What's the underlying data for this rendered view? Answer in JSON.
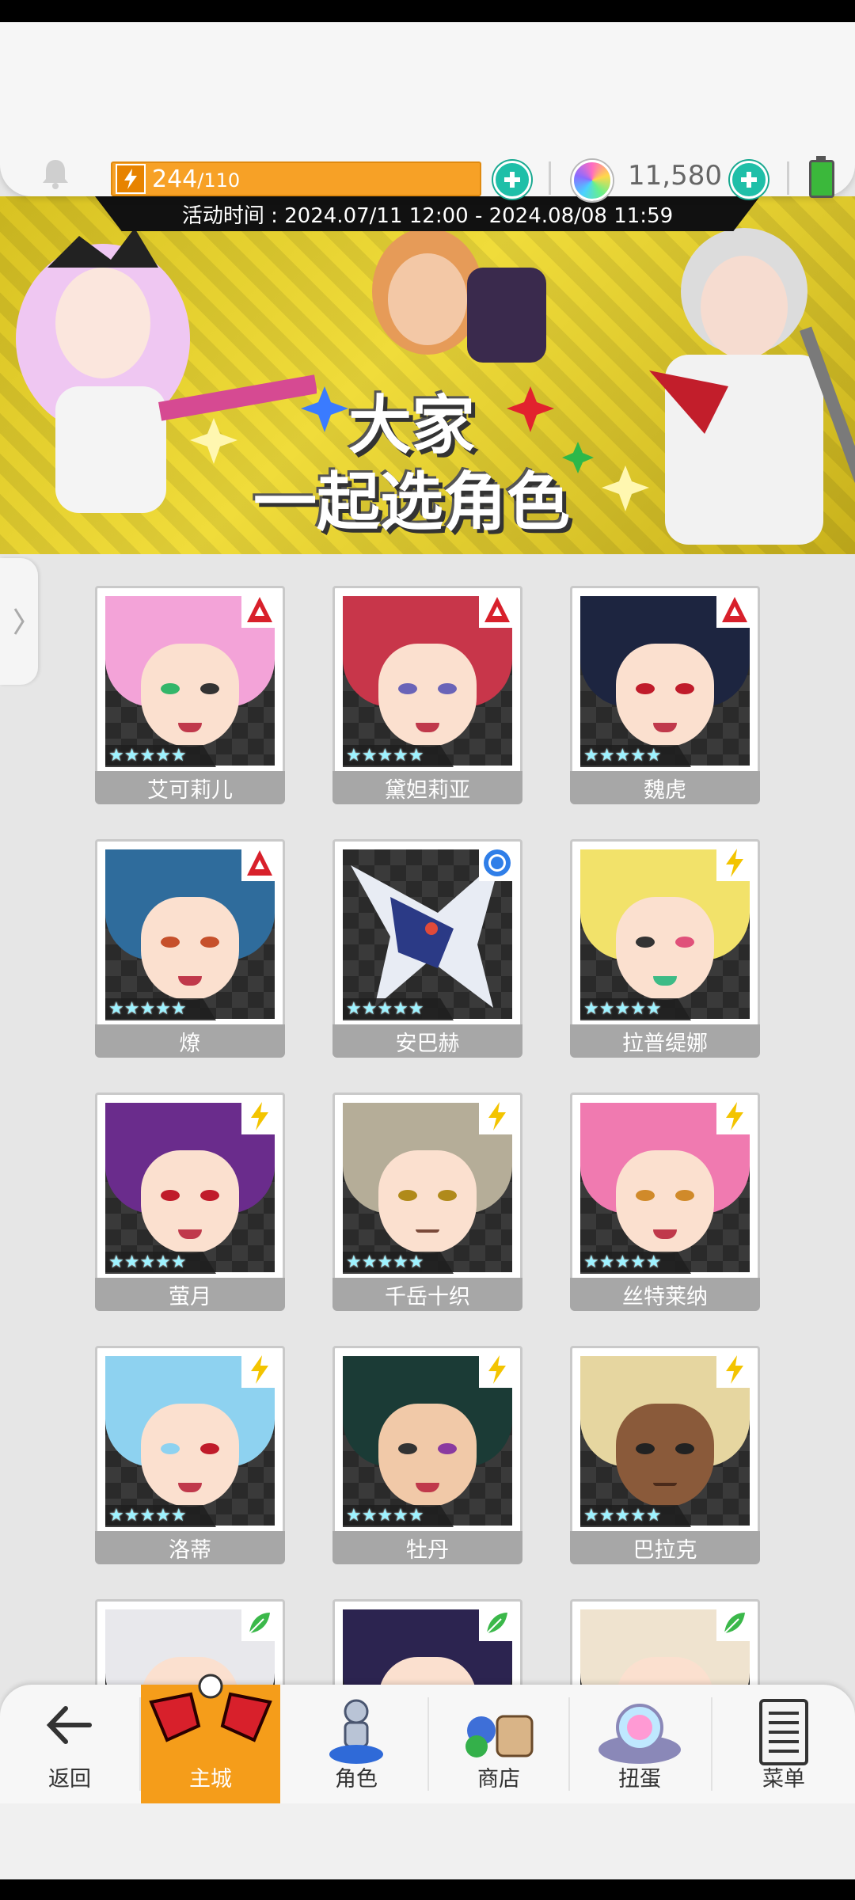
{
  "header": {
    "energy_current": "244",
    "energy_max": "/110",
    "gems": "11,580"
  },
  "banner": {
    "event_time": "活动时间 : 2024.07/11 12:00 - 2024.08/08 11:59",
    "title_line1": "大家",
    "title_line2": "一起选角色"
  },
  "characters": [
    {
      "name": "艾可莉儿",
      "badge": "red-diamond-icon"
    },
    {
      "name": "黛妲莉亚",
      "badge": "red-diamond-icon"
    },
    {
      "name": "魏虎",
      "badge": "red-diamond-icon"
    },
    {
      "name": "燎",
      "badge": "red-diamond-icon"
    },
    {
      "name": "安巴赫",
      "badge": "blue-circle-icon"
    },
    {
      "name": "拉普缇娜",
      "badge": "yellow-bolt-icon"
    },
    {
      "name": "萤月",
      "badge": "yellow-bolt-icon"
    },
    {
      "name": "千岳十织",
      "badge": "yellow-bolt-icon"
    },
    {
      "name": "丝特莱纳",
      "badge": "yellow-bolt-icon"
    },
    {
      "name": "洛蒂",
      "badge": "yellow-bolt-icon"
    },
    {
      "name": "牡丹",
      "badge": "yellow-bolt-icon"
    },
    {
      "name": "巴拉克",
      "badge": "yellow-bolt-icon"
    },
    {
      "name": "",
      "badge": "green-leaf-icon"
    },
    {
      "name": "",
      "badge": "green-leaf-icon"
    },
    {
      "name": "",
      "badge": "green-leaf-icon"
    }
  ],
  "nav": {
    "back": "返回",
    "main_city": "主城",
    "character": "角色",
    "shop": "商店",
    "gacha": "扭蛋",
    "menu": "菜单"
  },
  "colors": {
    "energy": "#f7a126",
    "plus": "#1fbfa8",
    "active_nav": "#f59d1a",
    "name_plate": "#a7a7a7"
  }
}
